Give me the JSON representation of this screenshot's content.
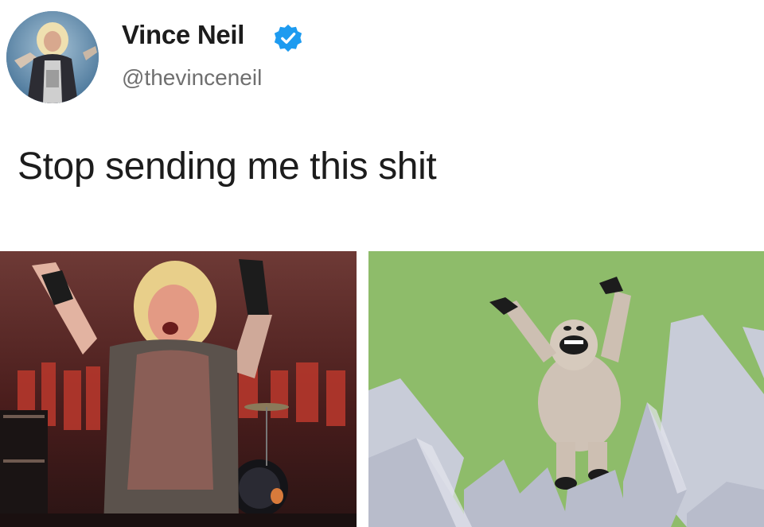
{
  "tweet": {
    "author": {
      "display_name": "Vince Neil",
      "handle": "@thevinceneil",
      "verified": true,
      "avatar_icon": "profile-photo"
    },
    "text": "Stop sending me this shit",
    "media": [
      {
        "description_icon": "concert-photo-singer-arms-raised"
      },
      {
        "description_icon": "abominable-snowman-figure-arms-raised"
      }
    ],
    "colors": {
      "verified_badge": "#1d9bf0",
      "name_text": "#1c1c1c",
      "handle_text": "#6f6f6f",
      "background": "#ffffff"
    }
  }
}
